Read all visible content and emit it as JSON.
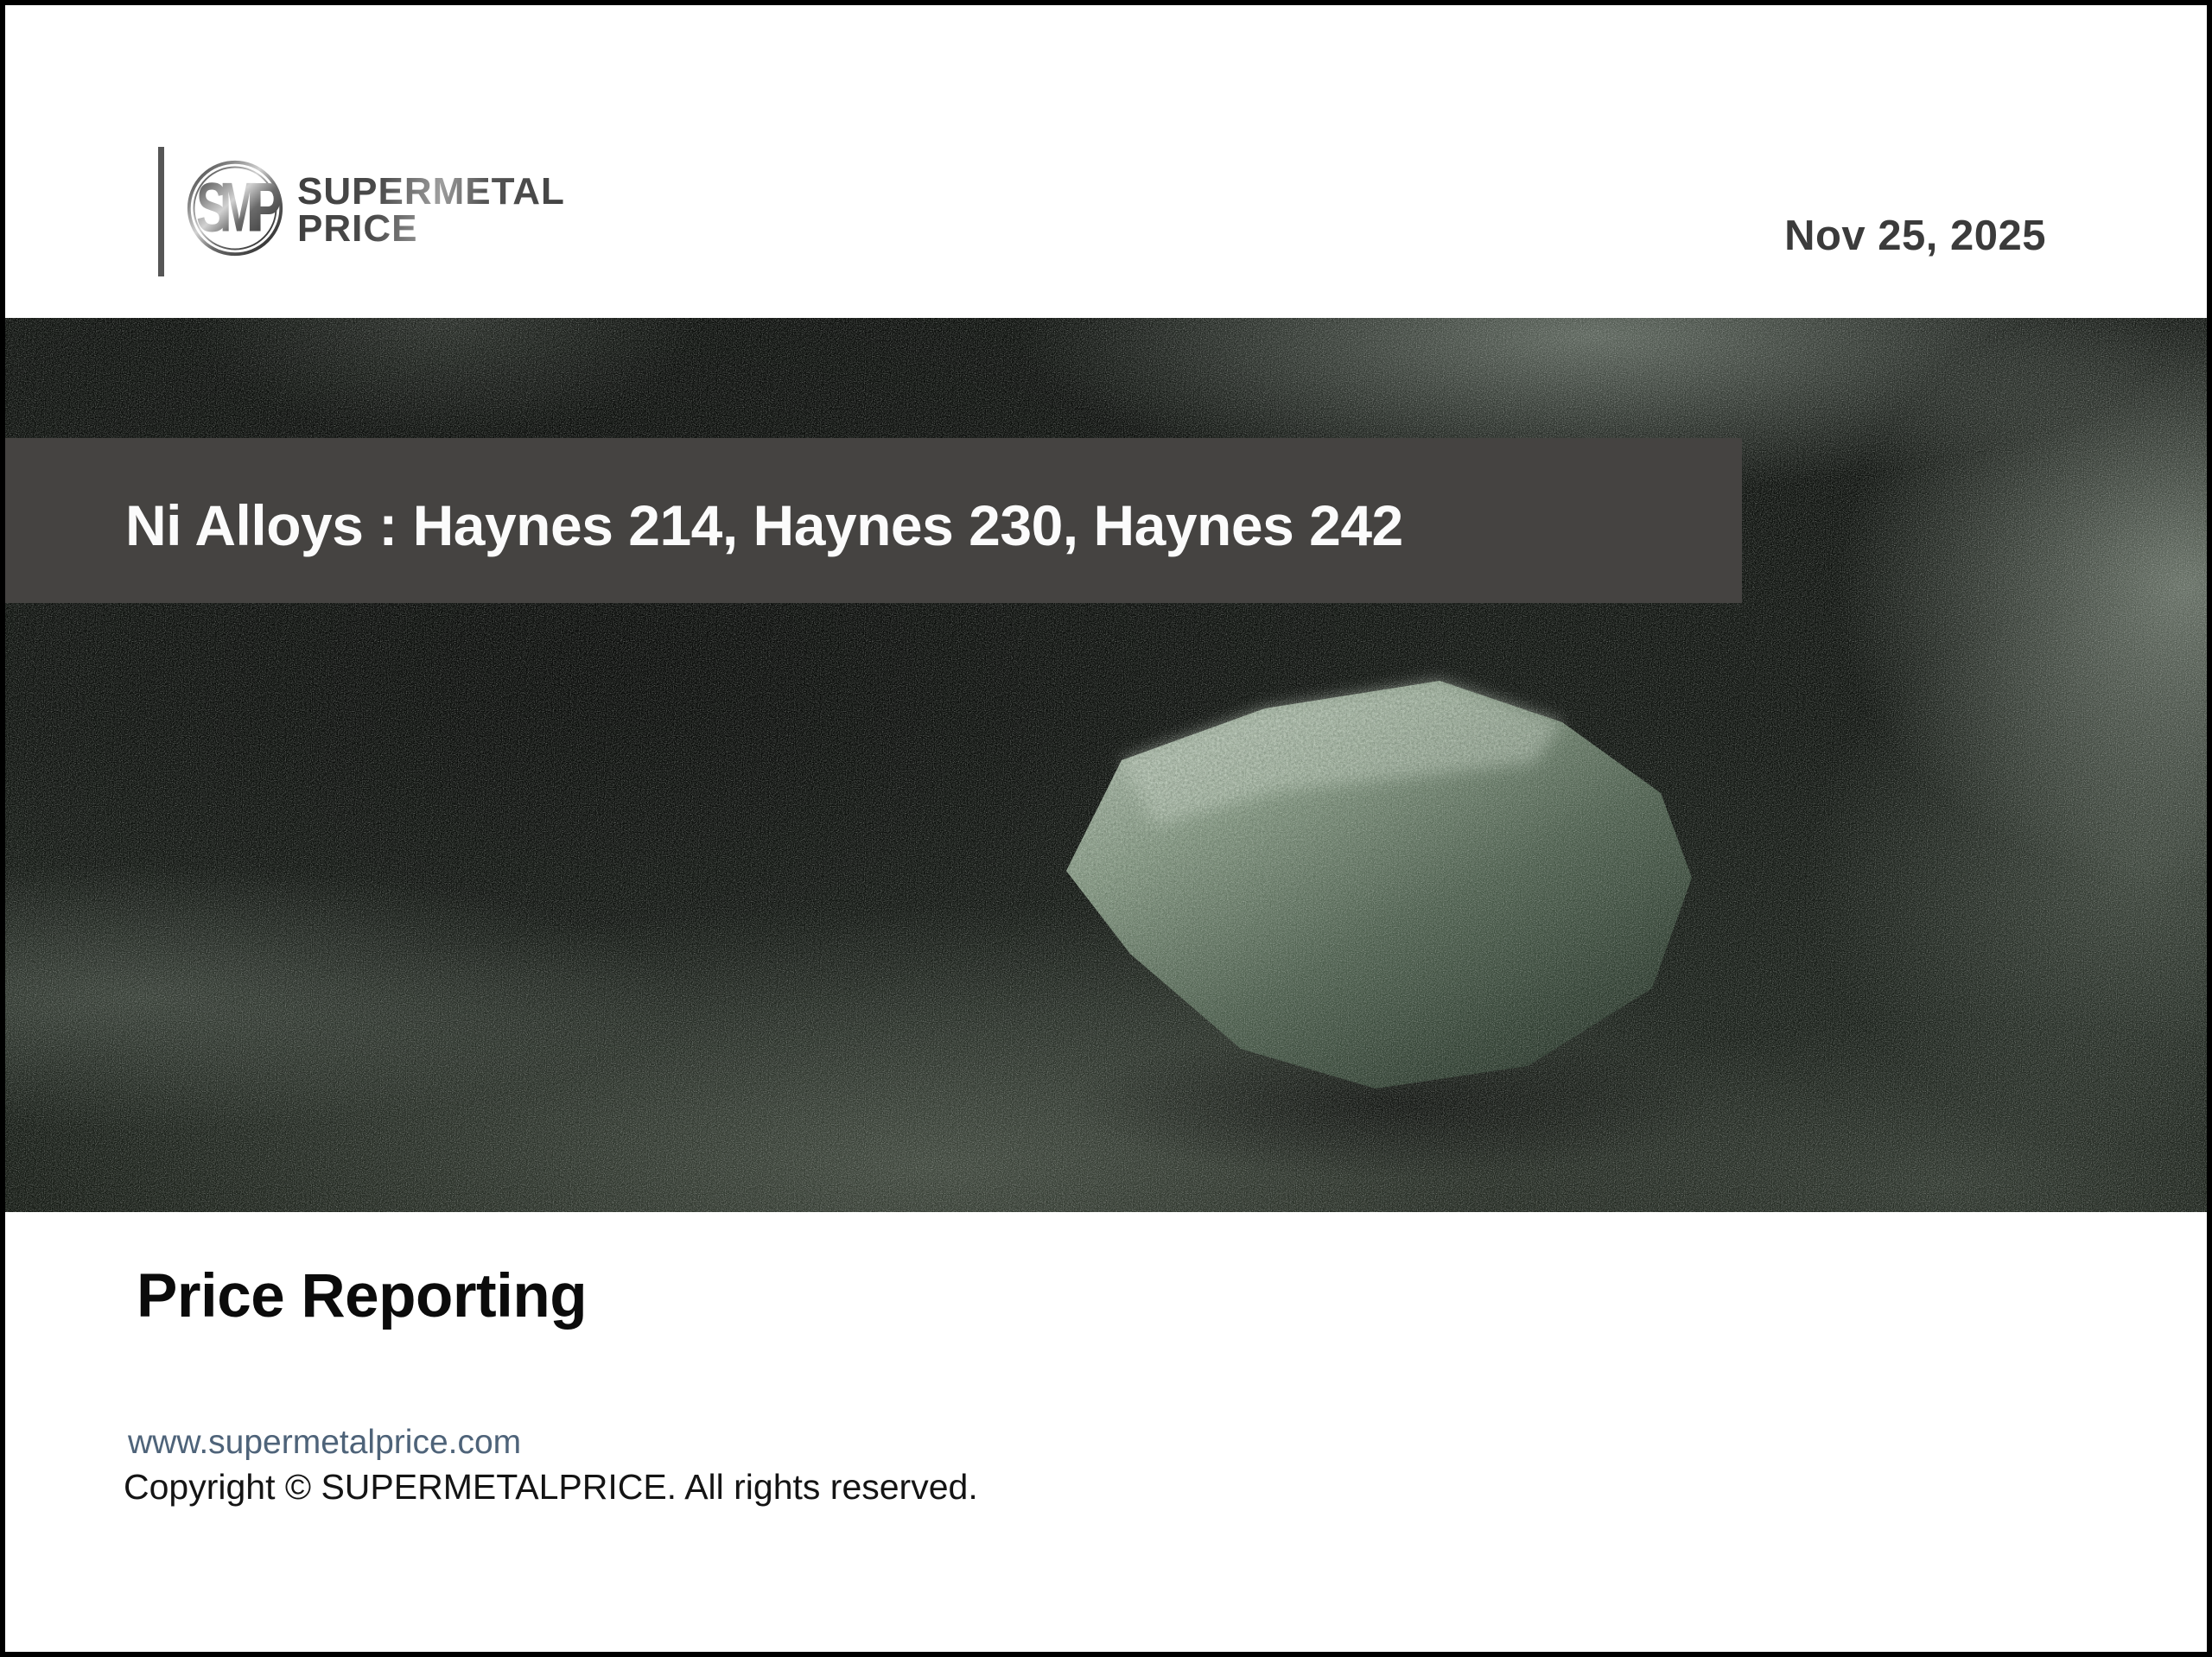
{
  "logo": {
    "monogram": "SMP",
    "line1": "SUPERMETAL",
    "line2": "PRICE"
  },
  "header": {
    "date": "Nov 25, 2025"
  },
  "banner": {
    "title": "Ni Alloys : Haynes 214, Haynes 230, Haynes 242"
  },
  "footer": {
    "heading": "Price Reporting",
    "website": "www.supermetalprice.com",
    "copyright": "Copyright © SUPERMETALPRICE. All rights reserved."
  },
  "icons": {
    "smp_monogram": "circular SMP metal monogram badge"
  },
  "colors": {
    "banner_bg": "#454341",
    "banner_text": "#fbfbfb",
    "link_text": "#4e6379",
    "date_text": "#3b3b3b",
    "accent_bar": "#565656",
    "heading_text": "#0b0b0b",
    "page_border": "#000000"
  }
}
